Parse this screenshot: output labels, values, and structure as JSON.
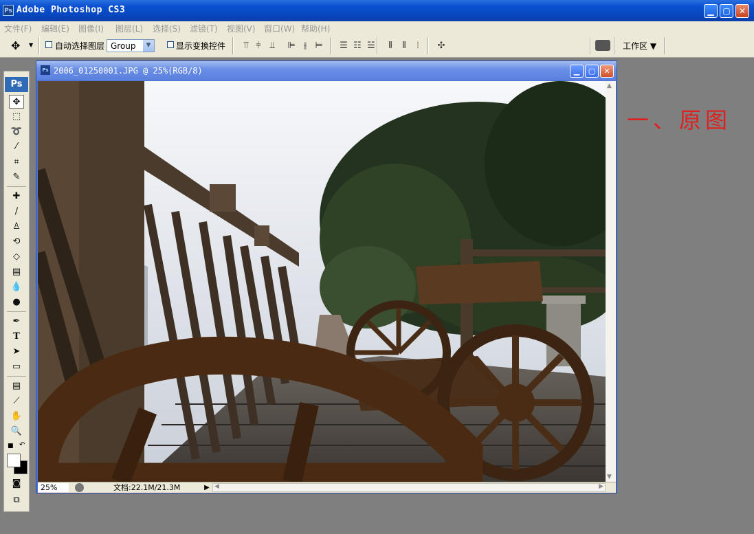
{
  "app": {
    "icon_text": "Ps",
    "title": "Adobe Photoshop CS3",
    "window_buttons": {
      "minimize": "▁",
      "maximize": "▢",
      "close": "✕"
    }
  },
  "menubar": {
    "items": [
      "文件(F)",
      "编辑(E)",
      "图像(I)",
      "图层(L)",
      "选择(S)",
      "滤镜(T)",
      "视图(V)",
      "窗口(W)",
      "帮助(H)"
    ]
  },
  "options": {
    "tool_icon": "move-tool-icon",
    "auto_select_label": "自动选择图层",
    "auto_select_value": "Group",
    "show_transform_label": "显示变换控件",
    "workspace_label": "工作区 ▼"
  },
  "toolbox": {
    "logo": "Ps"
  },
  "document": {
    "icon_text": "Ps",
    "title": "2006_01250001.JPG @ 25%(RGB/8)",
    "zoom": "25%",
    "doc_size": "文档:22.1M/21.3M",
    "buttons": {
      "minimize": "▁",
      "maximize": "▢",
      "close": "✕"
    }
  },
  "annotation": "一、原图",
  "colors": {
    "title_blue": "#0a50d0",
    "panel": "#ece9d8",
    "workspace": "#7f7f7f",
    "annotation_red": "#e02020"
  }
}
